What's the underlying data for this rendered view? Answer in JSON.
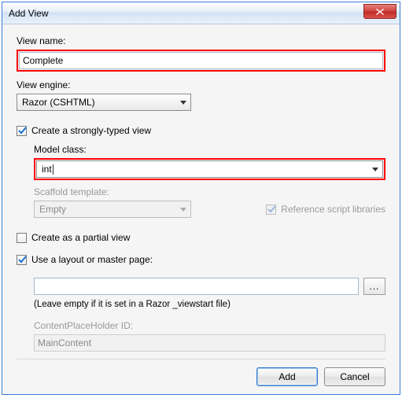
{
  "window": {
    "title": "Add View"
  },
  "labels": {
    "view_name": "View name:",
    "view_engine": "View engine:",
    "model_class": "Model class:",
    "scaffold_template": "Scaffold template:",
    "content_placeholder": "ContentPlaceHolder ID:"
  },
  "fields": {
    "view_name_value": "Complete",
    "view_engine_value": "Razor (CSHTML)",
    "model_class_value": "int",
    "scaffold_template_value": "Empty",
    "layout_path_value": "",
    "content_placeholder_value": "MainContent"
  },
  "checkboxes": {
    "strongly_typed": {
      "label": "Create a strongly-typed view",
      "checked": true
    },
    "reference_scripts": {
      "label": "Reference script libraries",
      "checked": true,
      "disabled": true
    },
    "partial_view": {
      "label": "Create as a partial view",
      "checked": false
    },
    "use_layout": {
      "label": "Use a layout or master page:",
      "checked": true
    }
  },
  "hints": {
    "layout_hint": "(Leave empty if it is set in a Razor _viewstart file)"
  },
  "buttons": {
    "browse": "...",
    "add": "Add",
    "cancel": "Cancel"
  }
}
